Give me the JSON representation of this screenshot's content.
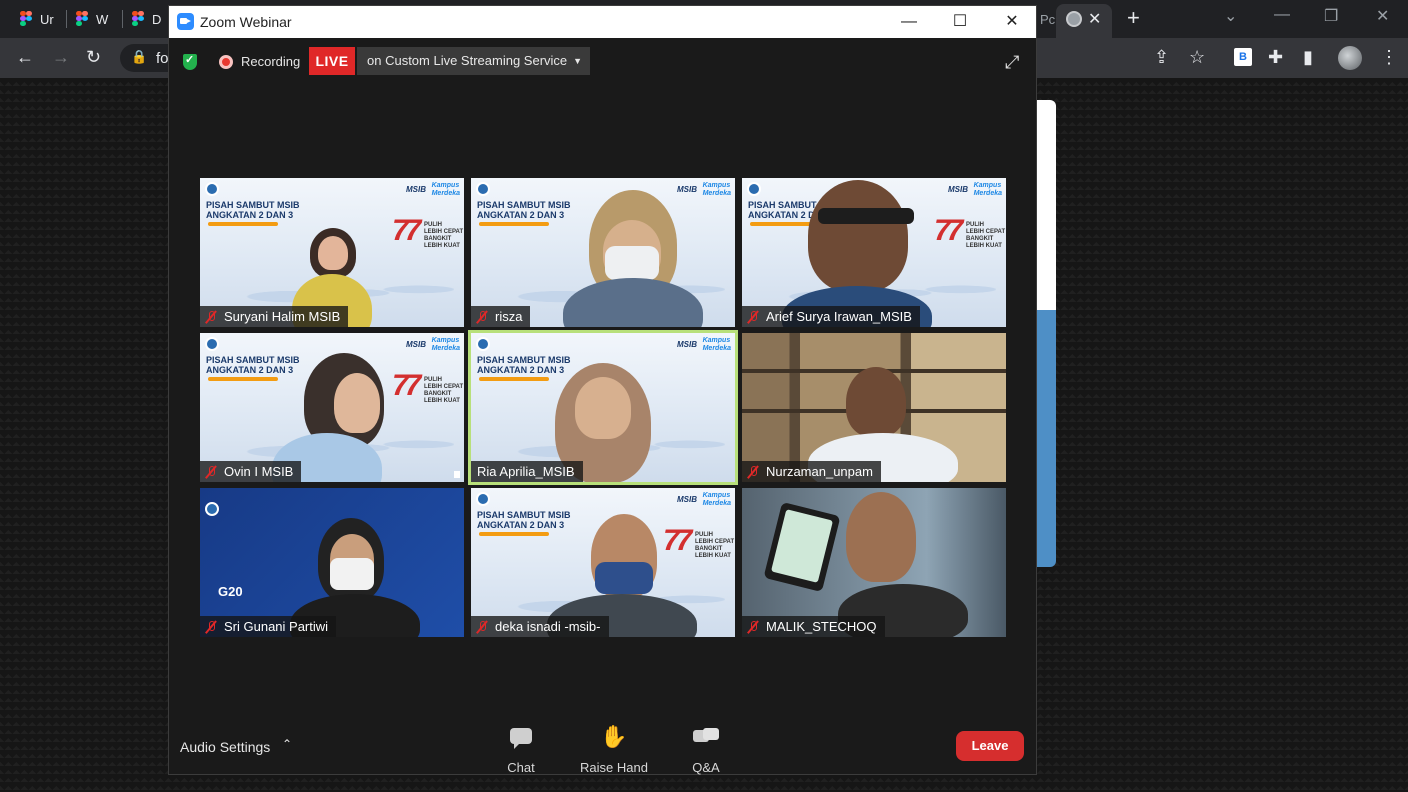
{
  "browser": {
    "tabs": [
      {
        "label": "Ur"
      },
      {
        "label": "W"
      },
      {
        "label": "D"
      }
    ],
    "right_tab_partial": "Pc",
    "omnibox_text": "fo",
    "extension_label": "B"
  },
  "zoom": {
    "title": "Zoom Webinar",
    "window_controls": {
      "minimize": "—",
      "maximize": "☐",
      "close": "✕"
    },
    "topbar": {
      "recording_label": "Recording",
      "live_badge": "LIVE",
      "stream_label": "on Custom Live Streaming Service"
    },
    "banner": {
      "title_line1": "PISAH SAMBUT MSIB",
      "title_line2": "ANGKATAN 2 DAN 3",
      "msib": "MSIB",
      "merdeka_line1": "Kampus",
      "merdeka_line2": "Merdeka",
      "seventy_seven": "77",
      "pulih_lines": [
        "PULIH",
        "LEBIH CEPAT",
        "BANGKIT",
        "LEBIH KUAT"
      ]
    },
    "participants": [
      {
        "name": "Suryani Halim MSIB"
      },
      {
        "name": "risza"
      },
      {
        "name": "Arief Surya Irawan_MSIB"
      },
      {
        "name": "Ovin I MSIB"
      },
      {
        "name": "Ria Aprilia_MSIB"
      },
      {
        "name": "Nurzaman_unpam"
      },
      {
        "name": "Sri Gunani Partiwi"
      },
      {
        "name": "deka isnadi -msib-"
      },
      {
        "name": "MALIK_STECHOQ"
      }
    ],
    "g20_label": "G20",
    "controls": {
      "audio_settings": "Audio Settings",
      "chat": "Chat",
      "raise_hand": "Raise Hand",
      "qa": "Q&A",
      "leave": "Leave"
    }
  },
  "colors": {
    "live_red": "#e02828",
    "leave_red": "#d62e2e",
    "active_speaker_outline": "#b8e07a",
    "zoom_blue": "#2d8cff"
  }
}
